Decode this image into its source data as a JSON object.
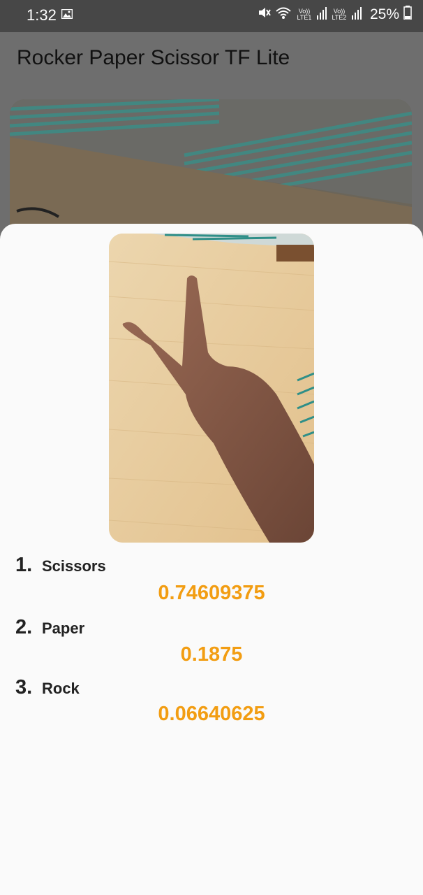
{
  "status_bar": {
    "time": "1:32",
    "battery_percent": "25%",
    "sim1_label_top": "Vo))",
    "sim1_label_bottom": "LTE1",
    "sim2_label_top": "Vo))",
    "sim2_label_bottom": "LTE2",
    "icons": [
      "gallery-icon",
      "mute-icon",
      "wifi-icon",
      "signal-icon",
      "signal-icon",
      "battery-icon"
    ]
  },
  "app_bar": {
    "title": "Rocker Paper Scissor TF Lite"
  },
  "results": [
    {
      "rank": "1.",
      "label": "Scissors",
      "score": "0.74609375"
    },
    {
      "rank": "2.",
      "label": "Paper",
      "score": "0.1875"
    },
    {
      "rank": "3.",
      "label": "Rock",
      "score": "0.06640625"
    }
  ],
  "colors": {
    "score": "#f29d12",
    "status_bar_bg": "#474747",
    "scrim_bg": "#6e6e6e",
    "sheet_bg": "#fafafa"
  }
}
